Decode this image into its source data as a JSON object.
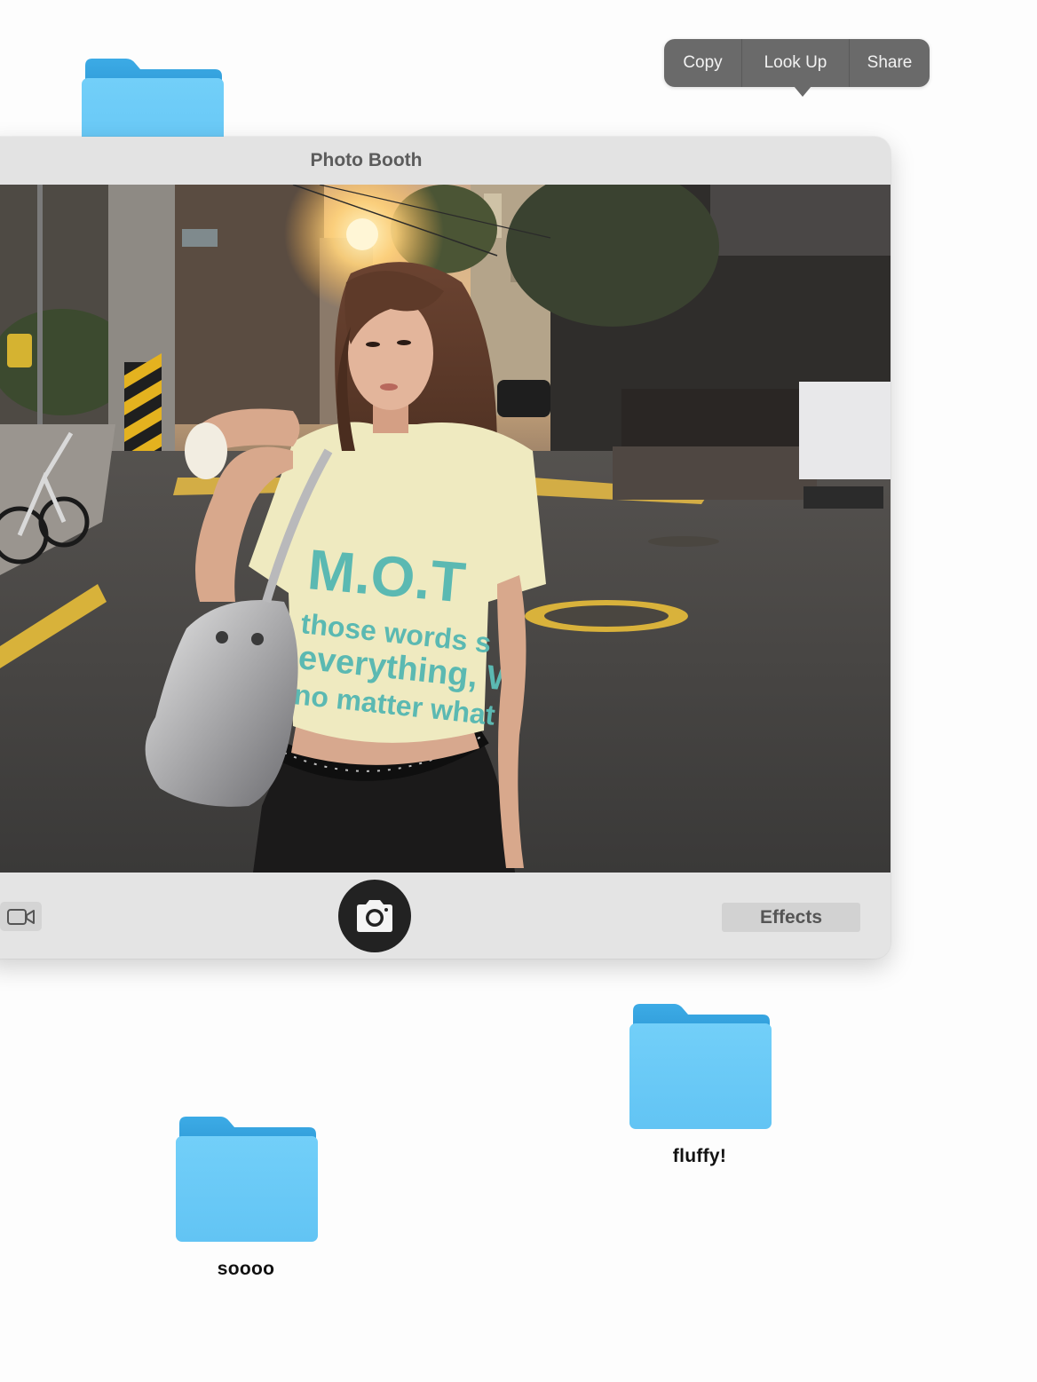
{
  "context_menu": {
    "items": [
      {
        "label": "Copy"
      },
      {
        "label": "Look Up"
      },
      {
        "label": "Share"
      }
    ]
  },
  "photo_booth": {
    "title": "Photo Booth",
    "effects_label": "Effects",
    "photo_shirt_text": [
      "M.O.T",
      "those words s",
      "everything, W",
      "no matter what"
    ]
  },
  "desktop": {
    "folders": [
      {
        "label": ""
      },
      {
        "label": "fluffy!"
      },
      {
        "label": "soooo"
      }
    ]
  },
  "colors": {
    "folder_front": "#6ccbf8",
    "folder_back": "#3aa9e4",
    "menu_bg": "#6a6a6a",
    "window_bg": "#e4e4e4"
  },
  "icons": {
    "video": "video-camera-icon",
    "shutter": "camera-icon",
    "folder": "folder-icon"
  }
}
